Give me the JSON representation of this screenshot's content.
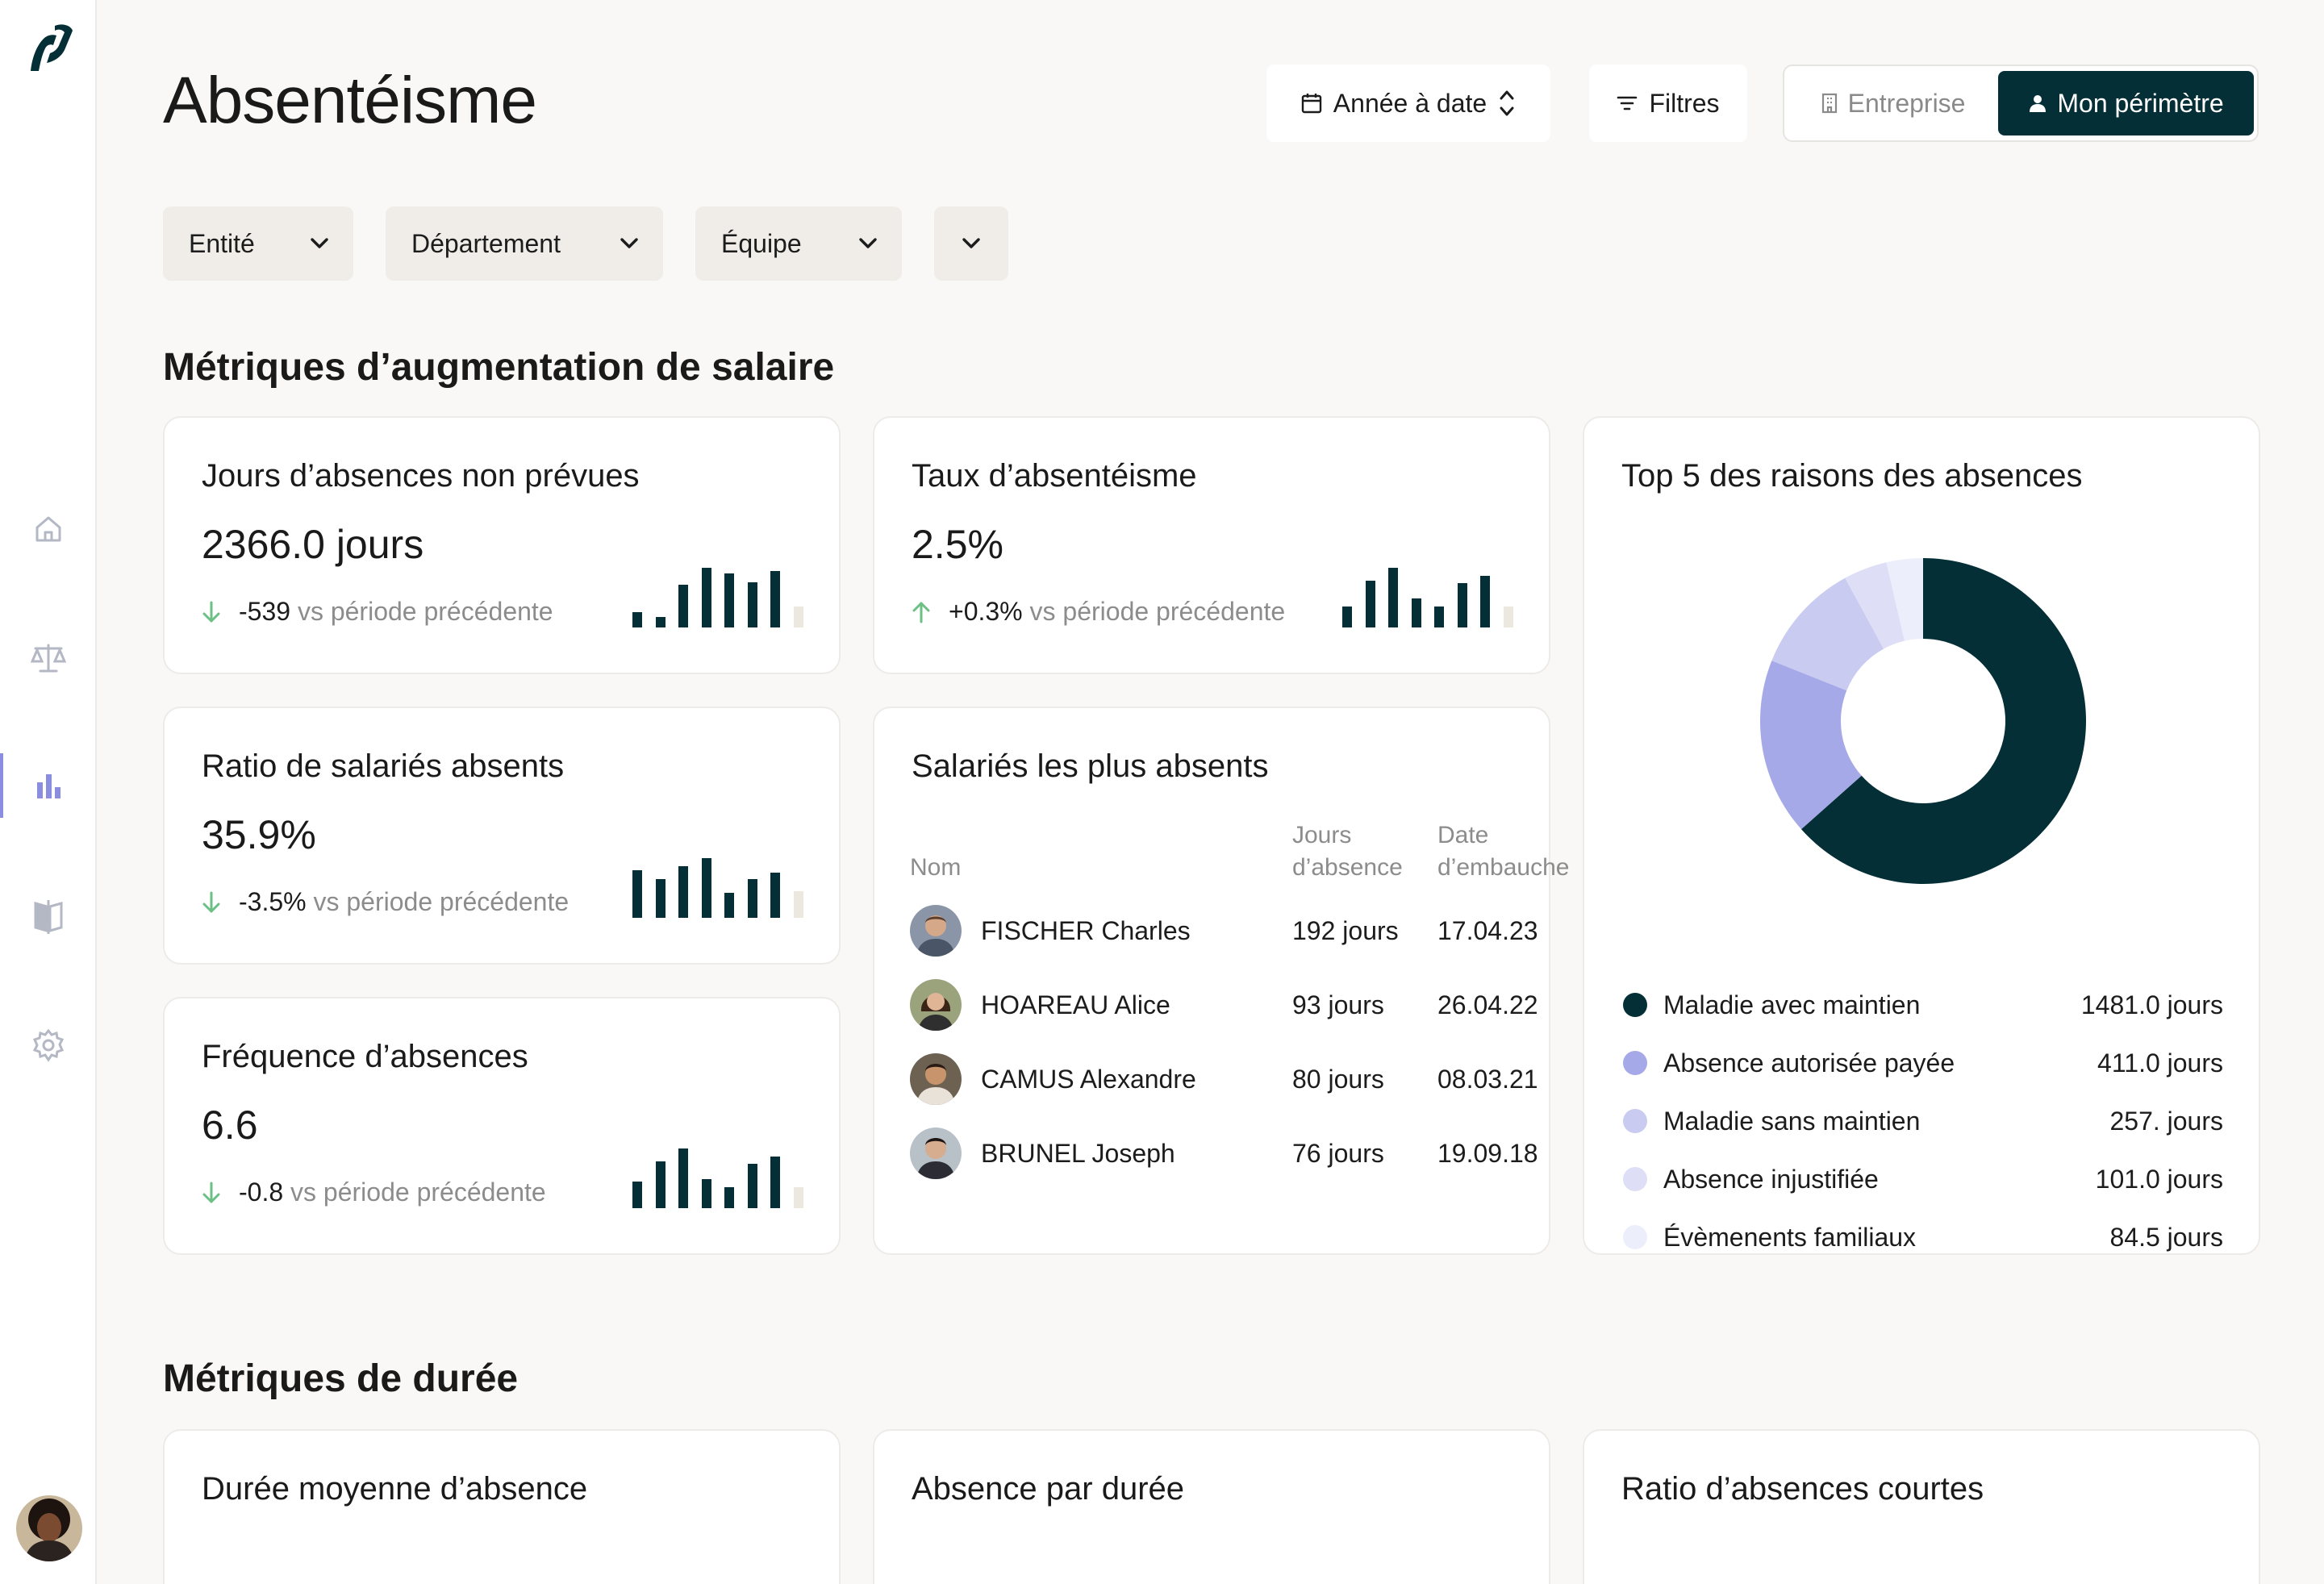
{
  "page": {
    "title": "Absentéisme"
  },
  "header": {
    "period_label": "Année à date",
    "filters_label": "Filtres",
    "scope_options": [
      "Entreprise",
      "Mon périmètre"
    ],
    "scope_selected": "Mon périmètre"
  },
  "filters": [
    {
      "label": "Entité"
    },
    {
      "label": "Département"
    },
    {
      "label": "Équipe"
    },
    {
      "label": ""
    }
  ],
  "sections": {
    "salary": "Métriques d’augmentation de salaire",
    "duration": "Métriques de durée"
  },
  "kpis": [
    {
      "title": "Jours d’absences non prévues",
      "value": "2366.0 jours",
      "delta": "-539",
      "delta_suffix": "vs période précédente",
      "trend": "down",
      "bars": [
        0.25,
        0.18,
        0.72,
        1.0,
        0.9,
        0.75,
        0.95,
        0.35
      ]
    },
    {
      "title": "Taux d’absentéisme",
      "value": "2.5%",
      "delta": "+0.3%",
      "delta_suffix": "vs période précédente",
      "trend": "up",
      "bars": [
        0.35,
        0.78,
        1.0,
        0.48,
        0.35,
        0.74,
        0.86,
        0.35
      ]
    },
    {
      "title": "Ratio de salariés absents",
      "value": "35.9%",
      "delta": "-3.5%",
      "delta_suffix": "vs période précédente",
      "trend": "down",
      "bars": [
        0.8,
        0.65,
        0.86,
        1.0,
        0.42,
        0.65,
        0.76,
        0.45
      ]
    },
    {
      "title": "Fréquence d’absences",
      "value": "6.6",
      "delta": "-0.8",
      "delta_suffix": "vs période précédente",
      "trend": "down",
      "bars": [
        0.45,
        0.78,
        1.0,
        0.48,
        0.35,
        0.74,
        0.86,
        0.35
      ]
    }
  ],
  "absent_table": {
    "title": "Salariés les plus absents",
    "col_name": "Nom",
    "col_days": [
      "Jours",
      "d’absence"
    ],
    "col_hire": [
      "Date",
      "d’embauche"
    ],
    "rows": [
      {
        "name": "FISCHER Charles",
        "days": "192 jours",
        "hire": "17.04.23"
      },
      {
        "name": "HOAREAU Alice",
        "days": "93 jours",
        "hire": "26.04.22"
      },
      {
        "name": "CAMUS Alexandre",
        "days": "80 jours",
        "hire": "08.03.21"
      },
      {
        "name": "BRUNEL Joseph",
        "days": "76 jours",
        "hire": "19.09.18"
      }
    ]
  },
  "chart_data": {
    "type": "pie",
    "title": "Top 5 des raisons des absences",
    "series": [
      {
        "name": "Maladie avec maintien",
        "value": 1481.0,
        "label": "1481.0 jours",
        "color": "#042f36"
      },
      {
        "name": "Absence autorisée payée",
        "value": 411.0,
        "label": "411.0 jours",
        "color": "#a6a9e7"
      },
      {
        "name": "Maladie sans maintien",
        "value": 257.0,
        "label": "257. jours",
        "color": "#c9cbf1"
      },
      {
        "name": "Absence injustifiée",
        "value": 101.0,
        "label": "101.0 jours",
        "color": "#dedff6"
      },
      {
        "name": "Évèmenents familiaux",
        "value": 84.5,
        "label": "84.5 jours",
        "color": "#eceefb"
      }
    ]
  },
  "duration_cards": [
    {
      "title": "Durée moyenne d’absence"
    },
    {
      "title": "Absence par durée"
    },
    {
      "title": "Ratio d’absences courtes"
    }
  ],
  "colors": {
    "accent": "#042f36",
    "positive": "#6cc085",
    "muted": "#8c8c8c"
  }
}
